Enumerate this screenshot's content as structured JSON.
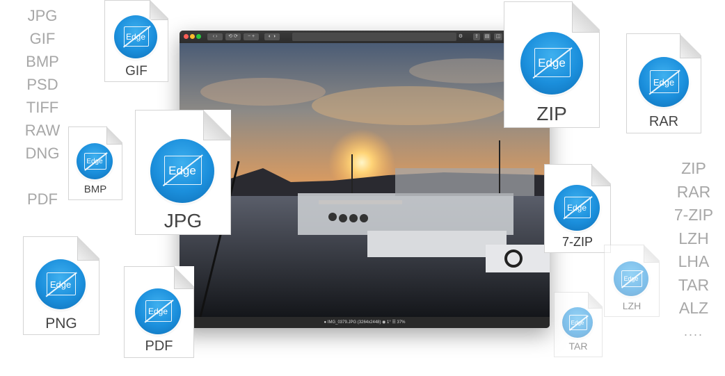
{
  "left_formats": [
    "JPG",
    "GIF",
    "BMP",
    "PSD",
    "TIFF",
    "RAW",
    "DNG",
    "",
    "PDF"
  ],
  "right_formats": [
    "ZIP",
    "RAR",
    "7-ZIP",
    "LZH",
    "LHA",
    "TAR",
    "ALZ",
    "...."
  ],
  "badge_word": "Edge",
  "docs": {
    "gif": "GIF",
    "bmp": "BMP",
    "jpg": "JPG",
    "png": "PNG",
    "pdf": "PDF",
    "zip": "ZIP",
    "rar": "RAR",
    "zip7": "7-ZIP",
    "lzh": "LZH",
    "tar": "TAR"
  },
  "window": {
    "status": "● IMG_0379.JPG (3264x2448)  ◉ 1°  ☰ 37%"
  },
  "colors": {
    "badge_blue": "#1b8fdc",
    "format_text": "#a7a7a7",
    "window_dark": "#1e1e1e"
  }
}
